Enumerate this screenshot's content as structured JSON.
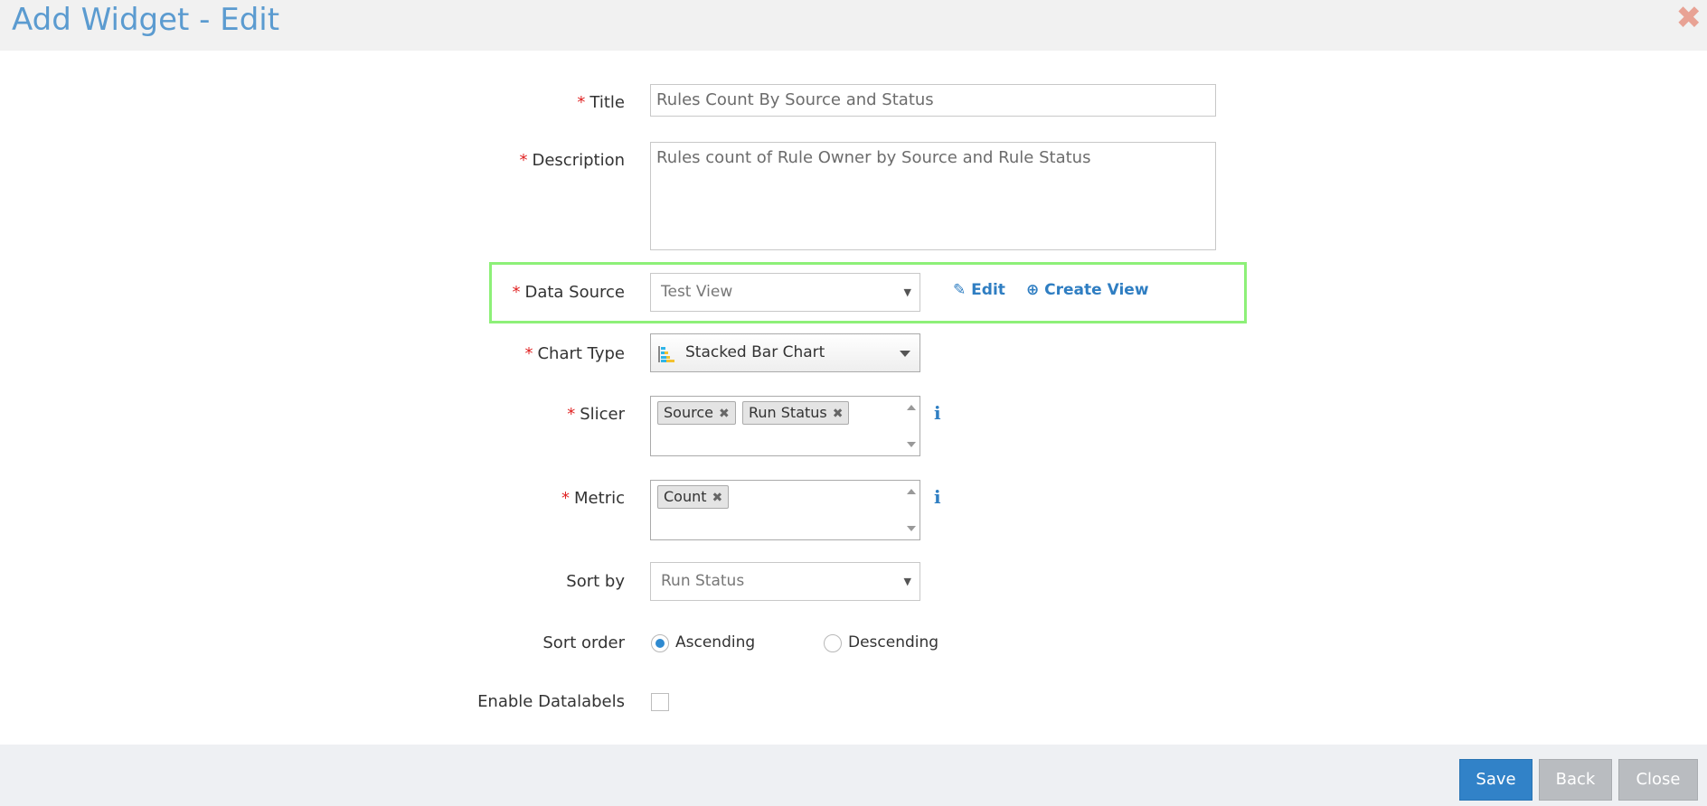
{
  "header": {
    "title": "Add Widget - Edit",
    "close_glyph": "✖"
  },
  "form": {
    "title": {
      "label": "Title",
      "required": "*",
      "value": "Rules Count By Source and Status"
    },
    "description": {
      "label": "Description",
      "required": "*",
      "value": "Rules count of Rule Owner by Source and Rule Status"
    },
    "data_source": {
      "label": "Data Source",
      "required": "*",
      "value": "Test View",
      "edit_link": "Edit",
      "create_link": "Create View"
    },
    "chart_type": {
      "label": "Chart Type",
      "required": "*",
      "value": "Stacked Bar Chart",
      "icon": "stacked-bar-chart-icon"
    },
    "slicer": {
      "label": "Slicer",
      "required": "*",
      "tags": [
        "Source",
        "Run Status"
      ]
    },
    "metric": {
      "label": "Metric",
      "required": "*",
      "tags": [
        "Count"
      ]
    },
    "sort_by": {
      "label": "Sort by",
      "value": "Run Status"
    },
    "sort_order": {
      "label": "Sort order",
      "options": [
        "Ascending",
        "Descending"
      ],
      "selected": "Ascending"
    },
    "datalabels": {
      "label": "Enable Datalabels",
      "checked": false
    }
  },
  "footer": {
    "save": "Save",
    "back": "Back",
    "close": "Close"
  },
  "colors": {
    "accent": "#3182c8",
    "title": "#5b9bd0",
    "highlight": "#8df078",
    "required": "#e02424"
  }
}
